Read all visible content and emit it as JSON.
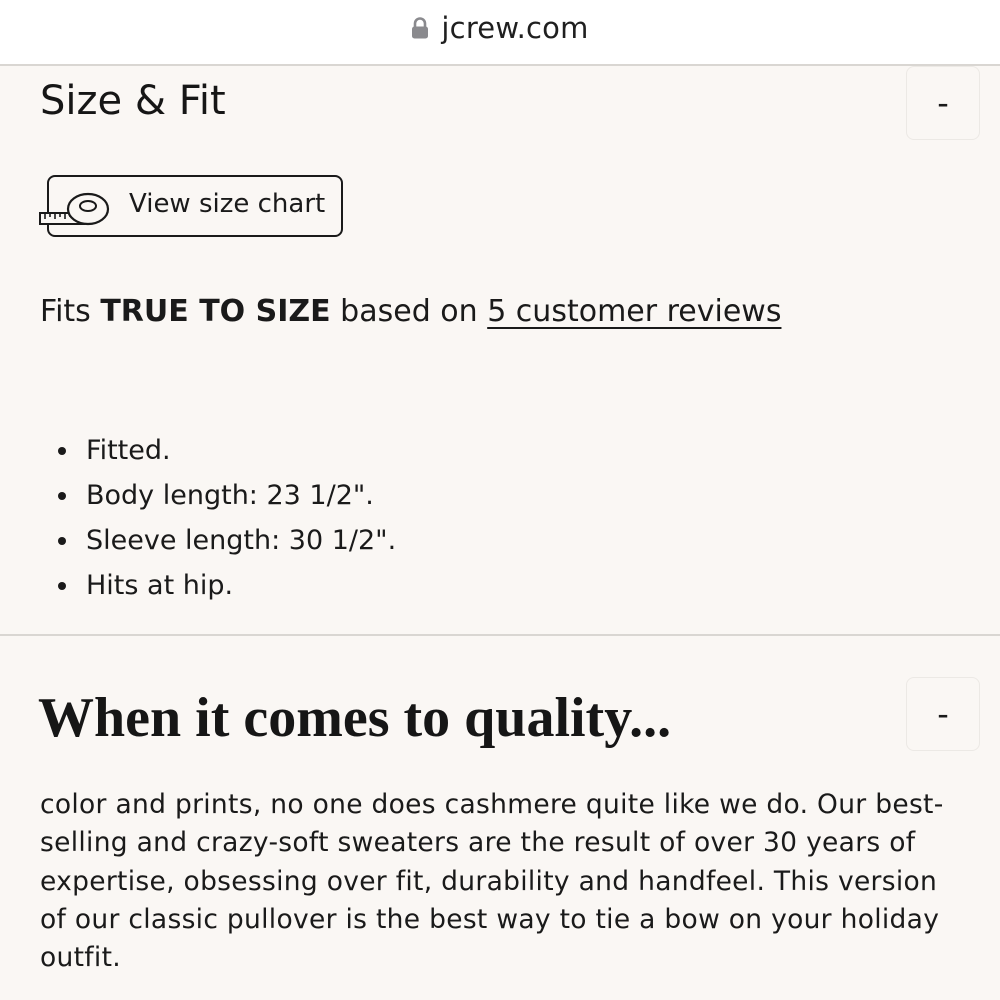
{
  "browser": {
    "url": "jcrew.com"
  },
  "size_fit": {
    "title": "Size & Fit",
    "collapse_label": "-",
    "size_chart_label": "View size chart",
    "fit_prefix": "Fits ",
    "fit_value": "TRUE TO SIZE",
    "fit_middle": " based on ",
    "reviews_link": "5 customer reviews",
    "details": [
      "Fitted.",
      "Body length: 23 1/2\".",
      "Sleeve length: 30 1/2\".",
      "Hits at hip."
    ]
  },
  "quality": {
    "title": "When it comes to quality...",
    "collapse_label": "-",
    "body": "color and prints, no one does cashmere quite like we do. Our best-selling and crazy-soft sweaters are the result of over 30 years of expertise, obsessing over fit, durability and handfeel. This version of our classic pullover is the best way to tie a bow on your holiday outfit."
  }
}
